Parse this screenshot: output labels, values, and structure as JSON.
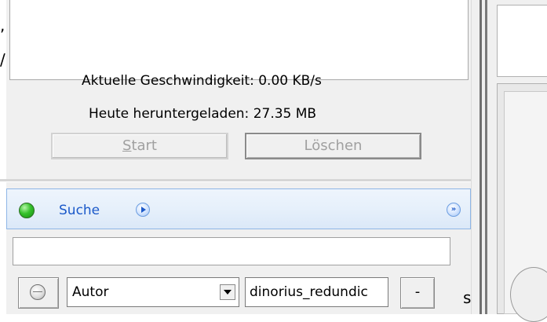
{
  "download_stats": {
    "current_speed_label": "Aktuelle Geschwindigkeit:",
    "current_speed_value": "0.00 KB/s",
    "downloaded_today_label": "Heute heruntergeladen:",
    "downloaded_today_value": "27.35 MB"
  },
  "buttons": {
    "start_prefix": "S",
    "start_rest": "tart",
    "delete": "Löschen"
  },
  "search": {
    "title": "Suche",
    "collapse_glyph": "»",
    "query_value": "",
    "filter": {
      "field_selected": "Autor",
      "term_value": "dinorius_redundic",
      "remove_label": "-"
    }
  },
  "stray_glyphs": {
    "top": ",",
    "mid": "/",
    "bottom": "s"
  },
  "colors": {
    "window_bg": "#f0f0f0",
    "search_header_accent": "#1b59c9",
    "status_green": "#36c12c"
  },
  "icons": {
    "search_status": "green-status-icon",
    "search_start": "play-icon",
    "search_collapse": "double-chevron-down-icon",
    "filter_toggle": "minus-circle-icon",
    "field_dropdown": "chevron-down-icon"
  }
}
